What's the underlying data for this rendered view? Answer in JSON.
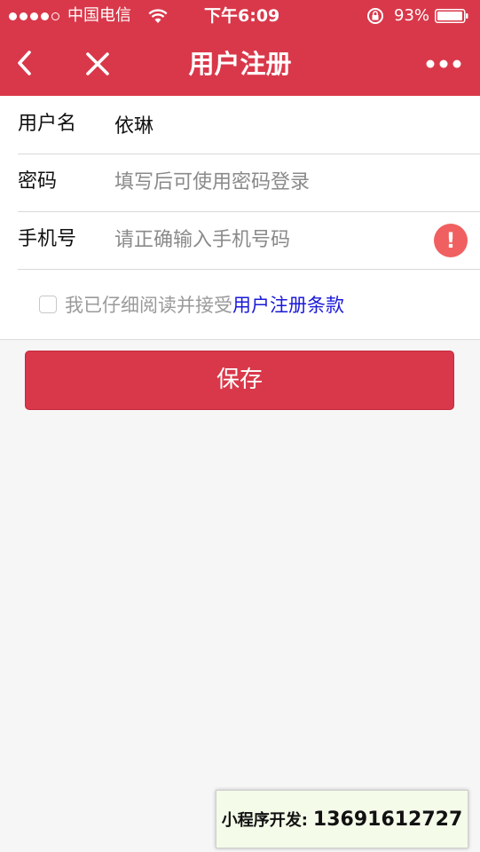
{
  "status_bar": {
    "carrier": "中国电信",
    "time": "下午6:09",
    "battery_percent": "93%",
    "signal_bars_filled": 4,
    "signal_bars_total": 5
  },
  "nav": {
    "title": "用户注册",
    "back_icon": "chevron-left-icon",
    "close_icon": "close-icon",
    "more_icon": "more-dots-icon"
  },
  "form": {
    "username": {
      "label": "用户名",
      "value": "依琳",
      "placeholder": ""
    },
    "password": {
      "label": "密码",
      "value": "",
      "placeholder": "填写后可使用密码登录"
    },
    "phone": {
      "label": "手机号",
      "value": "",
      "placeholder": "请正确输入手机号码",
      "warning_icon": "!"
    }
  },
  "agreement": {
    "text": "我已仔细阅读并接受",
    "link": "用户注册条款",
    "checked": false
  },
  "save_button": {
    "label": "保存"
  },
  "contact": {
    "label": "小程序开发:",
    "phone": "13691612727"
  },
  "colors": {
    "brand": "#d9384a",
    "link": "#1a1ad9",
    "warning": "#f06060",
    "background": "#f6f6f6"
  }
}
